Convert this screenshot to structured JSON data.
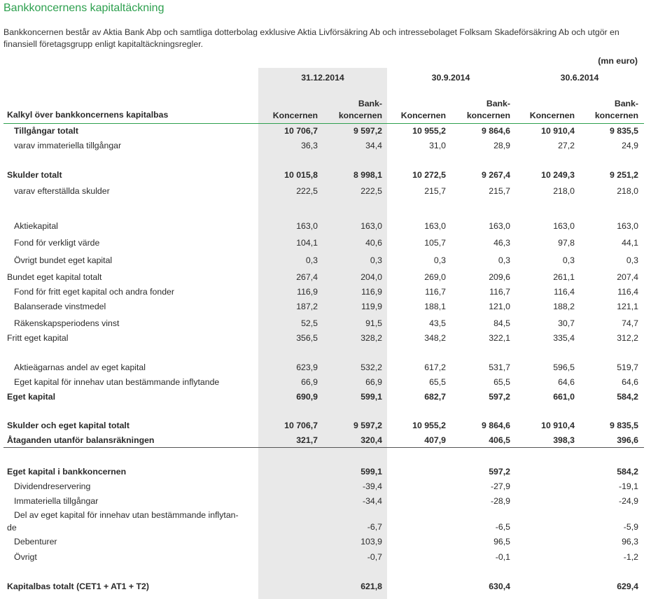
{
  "title": "Bankkoncernens kapitaltäckning",
  "intro": "Bankkoncernen består av Aktia Bank Abp och samtliga dotterbolag exklusive Aktia Livförsäkring Ab och intressebolaget Folksam Skadeförsäkring Ab och utgör en finansiell företagsgrupp enligt kapitaltäckningsregler.",
  "unit": "(mn euro)",
  "header": {
    "label": "Kalkyl över bankkoncernens kapitalbas",
    "dates": [
      "31.12.2014",
      "30.9.2014",
      "30.6.2014"
    ],
    "col_a": "Koncernen",
    "col_b_line1": "Bank-",
    "col_b_line2": "koncernen"
  },
  "rows": [
    {
      "label": "Tillgångar totalt",
      "v": [
        "10 706,7",
        "9 597,2",
        "10 955,2",
        "9 864,6",
        "10 910,4",
        "9 835,5"
      ]
    },
    {
      "label": "varav immateriella tillgångar",
      "v": [
        "36,3",
        "34,4",
        "31,0",
        "28,9",
        "27,2",
        "24,9"
      ]
    },
    {
      "label": "Skulder totalt",
      "v": [
        "10 015,8",
        "8 998,1",
        "10 272,5",
        "9 267,4",
        "10 249,3",
        "9 251,2"
      ]
    },
    {
      "label": "varav efterställda skulder",
      "v": [
        "222,5",
        "222,5",
        "215,7",
        "215,7",
        "218,0",
        "218,0"
      ]
    },
    {
      "label": "Aktiekapital",
      "v": [
        "163,0",
        "163,0",
        "163,0",
        "163,0",
        "163,0",
        "163,0"
      ]
    },
    {
      "label": "Fond för verkligt värde",
      "v": [
        "104,1",
        "40,6",
        "105,7",
        "46,3",
        "97,8",
        "44,1"
      ]
    },
    {
      "label": "Övrigt bundet eget kapital",
      "v": [
        "0,3",
        "0,3",
        "0,3",
        "0,3",
        "0,3",
        "0,3"
      ]
    },
    {
      "label": "Bundet eget kapital totalt",
      "v": [
        "267,4",
        "204,0",
        "269,0",
        "209,6",
        "261,1",
        "207,4"
      ]
    },
    {
      "label": "Fond för fritt eget kapital och andra fonder",
      "v": [
        "116,9",
        "116,9",
        "116,7",
        "116,7",
        "116,4",
        "116,4"
      ]
    },
    {
      "label": "Balanserade vinstmedel",
      "v": [
        "187,2",
        "119,9",
        "188,1",
        "121,0",
        "188,2",
        "121,1"
      ]
    },
    {
      "label": "Räkenskapsperiodens vinst",
      "v": [
        "52,5",
        "91,5",
        "43,5",
        "84,5",
        "30,7",
        "74,7"
      ]
    },
    {
      "label": "Fritt eget kapital",
      "v": [
        "356,5",
        "328,2",
        "348,2",
        "322,1",
        "335,4",
        "312,2"
      ]
    },
    {
      "label": "Aktieägarnas andel av eget kapital",
      "v": [
        "623,9",
        "532,2",
        "617,2",
        "531,7",
        "596,5",
        "519,7"
      ]
    },
    {
      "label": "Eget kapital för innehav utan bestämmande inflytande",
      "v": [
        "66,9",
        "66,9",
        "65,5",
        "65,5",
        "64,6",
        "64,6"
      ]
    },
    {
      "label": "Eget kapital",
      "v": [
        "690,9",
        "599,1",
        "682,7",
        "597,2",
        "661,0",
        "584,2"
      ]
    },
    {
      "label": "Skulder och eget kapital totalt",
      "v": [
        "10 706,7",
        "9 597,2",
        "10 955,2",
        "9 864,6",
        "10 910,4",
        "9 835,5"
      ]
    },
    {
      "label": "Åtaganden utanför balansräkningen",
      "v": [
        "321,7",
        "320,4",
        "407,9",
        "406,5",
        "398,3",
        "396,6"
      ]
    }
  ],
  "capital_rows": [
    {
      "label": "Eget kapital i bankkoncernen",
      "v": [
        "599,1",
        "597,2",
        "584,2"
      ]
    },
    {
      "label": "Dividendreservering",
      "v": [
        "-39,4",
        "-27,9",
        "-19,1"
      ]
    },
    {
      "label": "Immateriella tillgångar",
      "v": [
        "-34,4",
        "-28,9",
        "-24,9"
      ]
    },
    {
      "label": "Del av eget kapital för innehav utan bestämmande inflytan-de",
      "v": [
        "-6,7",
        "-6,5",
        "-5,9"
      ]
    },
    {
      "label": "Debenturer",
      "v": [
        "103,9",
        "96,5",
        "96,3"
      ]
    },
    {
      "label": "Övrigt",
      "v": [
        "-0,7",
        "-0,1",
        "-1,2"
      ]
    },
    {
      "label": "Kapitalbas totalt (CET1 + AT1 + T2)",
      "v": [
        "621,8",
        "630,4",
        "629,4"
      ]
    }
  ],
  "wrapped_label": {
    "line1": "Del av eget kapital för innehav utan bestämmande inflytan-",
    "line2": "de"
  }
}
